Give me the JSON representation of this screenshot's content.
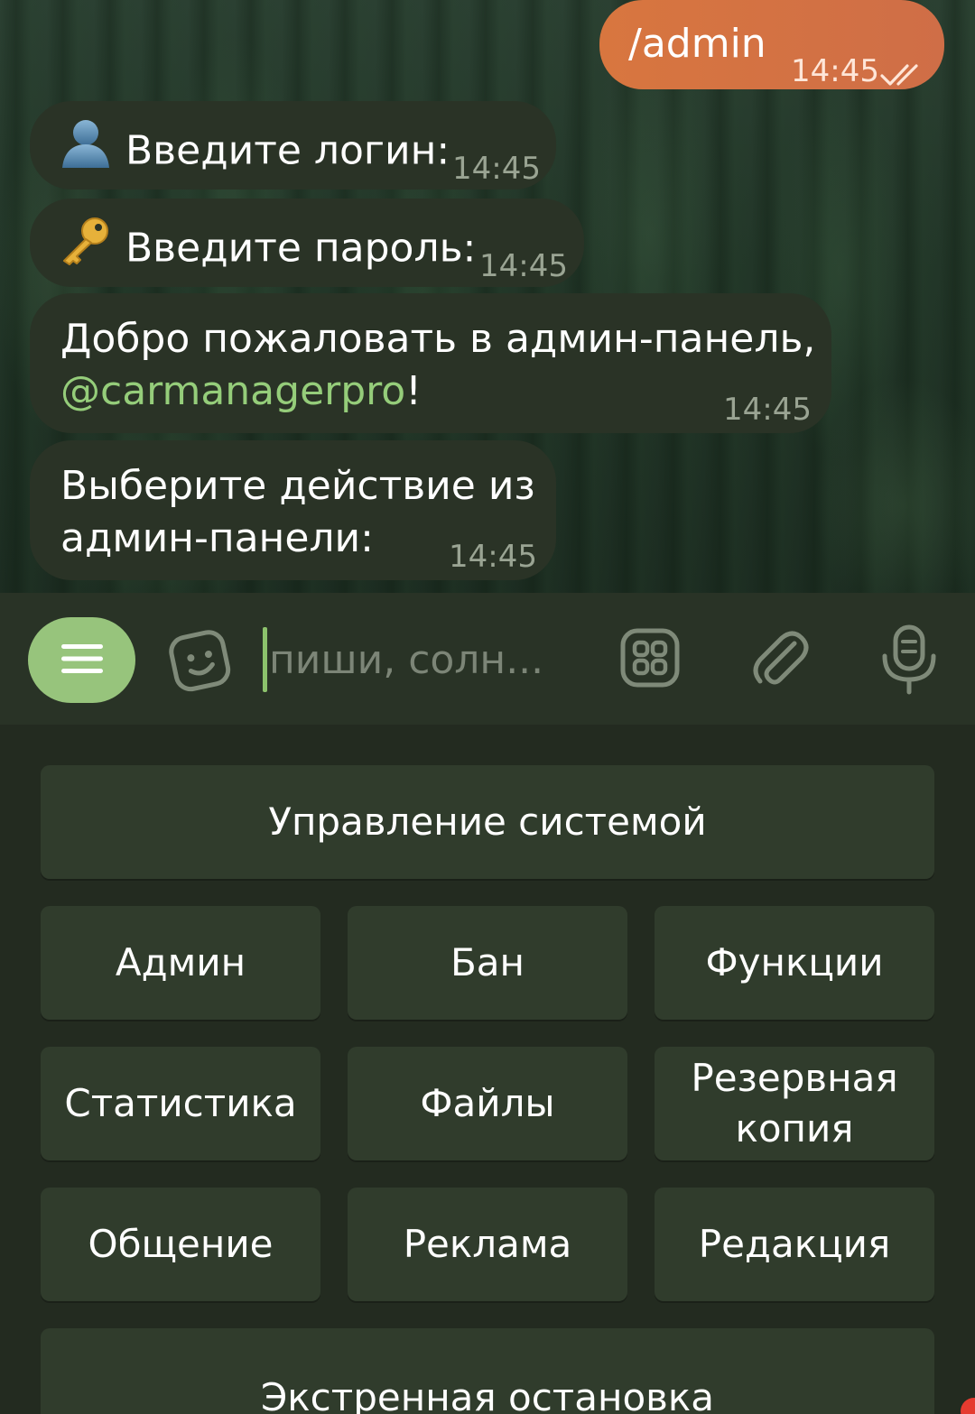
{
  "chat": {
    "outgoing": {
      "text": "/admin",
      "time": "14:45"
    },
    "messages": [
      {
        "emoji": "bust-silhouette",
        "text": "Введите логин:",
        "time": "14:45"
      },
      {
        "emoji": "key",
        "text": "Введите пароль:",
        "time": "14:45"
      },
      {
        "line1": "Добро пожаловать в админ-панель,",
        "mention": "@carmanagerpro",
        "suffix": "!",
        "time": "14:45"
      },
      {
        "line1": "Выберите действие из",
        "line2": "админ-панели:",
        "time": "14:45"
      }
    ]
  },
  "input": {
    "placeholder": "пиши, солн...",
    "icons": [
      "menu-icon",
      "sticker-icon",
      "bot-commands-icon",
      "attach-icon",
      "microphone-icon"
    ]
  },
  "keyboard": {
    "rows": [
      [
        "Управление системой"
      ],
      [
        "Админ",
        "Бан",
        "Функции"
      ],
      [
        "Статистика",
        "Файлы",
        "Резервная копия"
      ],
      [
        "Общение",
        "Реклама",
        "Редакция"
      ],
      [
        "Экстренная остановка"
      ]
    ],
    "backup_line1": "Резервная",
    "backup_line2": "копия"
  },
  "colors": {
    "accent": "#97c47c",
    "outgoing_bubble": "#d8763f",
    "incoming_bubble": "#2a3326",
    "keyboard_button": "#303c2c",
    "mention": "#95cd7a"
  }
}
